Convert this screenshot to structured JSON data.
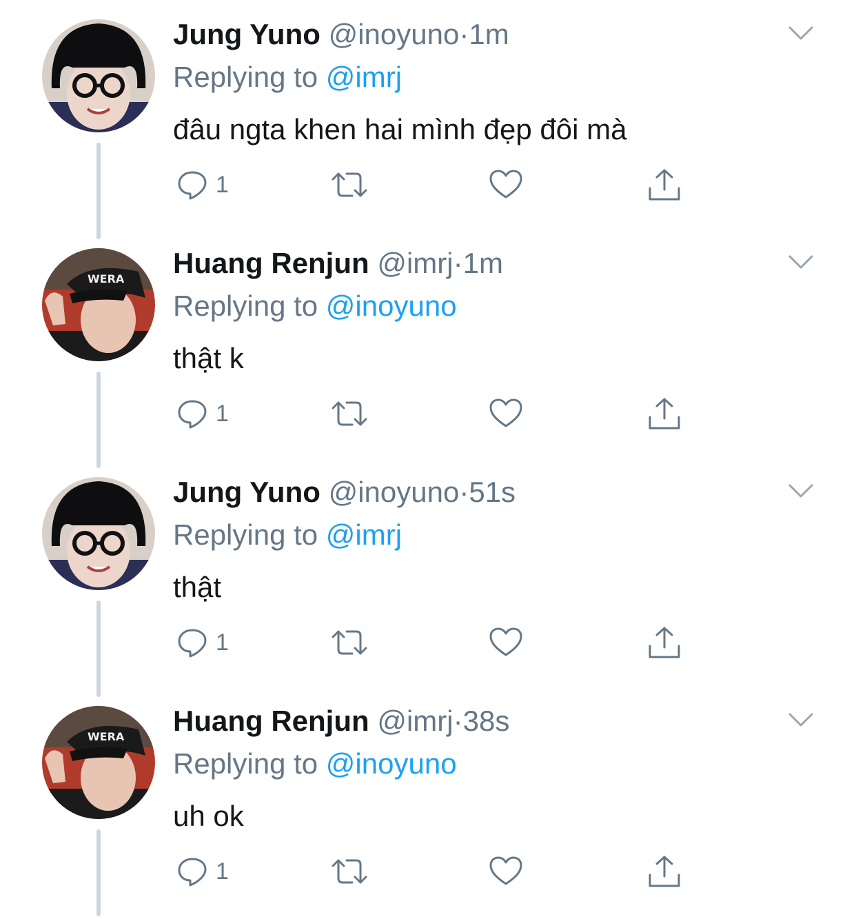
{
  "tweets": [
    {
      "name": "Jung Yuno",
      "handle": "@inoyuno",
      "separator": "·",
      "time": "1m",
      "replying_prefix": "Replying to",
      "replying_handle": "@imrj",
      "text": "đâu ngta khen hai mình đẹp đôi mà",
      "reply_count": "1",
      "avatar": "jung-yuno-avatar"
    },
    {
      "name": "Huang Renjun",
      "handle": "@imrj",
      "separator": "·",
      "time": "1m",
      "replying_prefix": "Replying to",
      "replying_handle": "@inoyuno",
      "text": "thật k",
      "reply_count": "1",
      "avatar": "huang-renjun-avatar"
    },
    {
      "name": "Jung Yuno",
      "handle": "@inoyuno",
      "separator": "·",
      "time": "51s",
      "replying_prefix": "Replying to",
      "replying_handle": "@imrj",
      "text": "thật",
      "reply_count": "1",
      "avatar": "jung-yuno-avatar"
    },
    {
      "name": "Huang Renjun",
      "handle": "@imrj",
      "separator": "·",
      "time": "38s",
      "replying_prefix": "Replying to",
      "replying_handle": "@inoyuno",
      "text": "uh ok",
      "reply_count": "1",
      "avatar": "huang-renjun-avatar"
    }
  ],
  "icons": {
    "reply": "reply-icon",
    "retweet": "retweet-icon",
    "like": "heart-icon",
    "share": "share-icon",
    "menu": "chevron-down-icon"
  },
  "colors": {
    "name": "#14171a",
    "secondary": "#657786",
    "link": "#1da1f2",
    "thread_line": "#cdd6e0",
    "background": "#ffffff"
  }
}
